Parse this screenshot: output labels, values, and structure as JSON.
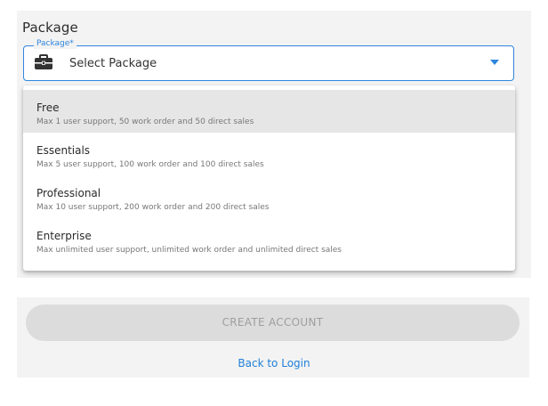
{
  "package_section": {
    "title": "Package",
    "field_label": "Package*",
    "selected_value": "Select Package",
    "options": [
      {
        "name": "Free",
        "description": "Max 1 user support, 50 work order and 50 direct sales"
      },
      {
        "name": "Essentials",
        "description": "Max 5 user support, 100 work order and 100 direct sales"
      },
      {
        "name": "Professional",
        "description": "Max 10 user support, 200 work order and 200 direct sales"
      },
      {
        "name": "Enterprise",
        "description": "Max unlimited user support, unlimited work order and unlimited direct sales"
      }
    ]
  },
  "actions": {
    "create_account_label": "CREATE ACCOUNT",
    "back_to_login_label": "Back to Login"
  },
  "colors": {
    "accent": "#2e86de",
    "link": "#1e7fd8",
    "disabled_button": "#dcdcdc",
    "highlight": "#e6e6e6"
  },
  "icons": {
    "field_icon": "briefcase-icon",
    "dropdown_icon": "caret-down-icon"
  }
}
